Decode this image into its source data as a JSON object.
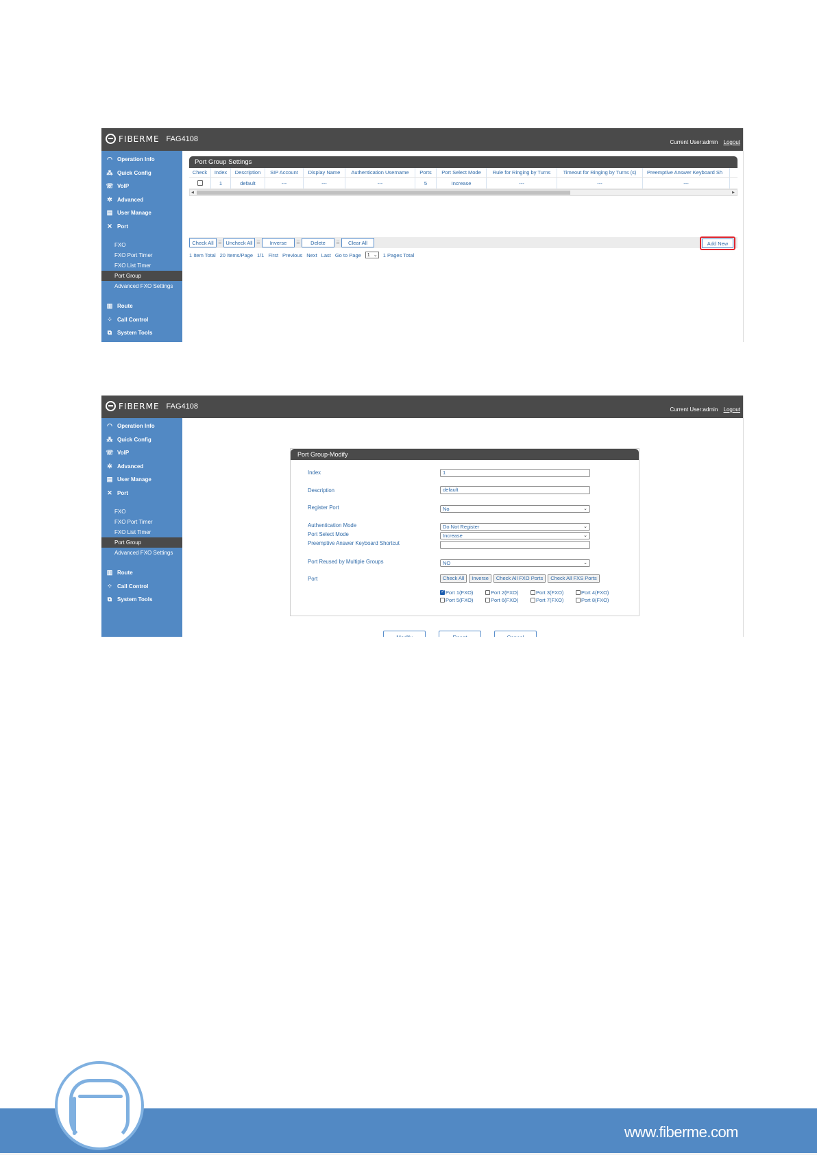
{
  "brand": {
    "logo_text": "FIBERME",
    "model": "FAG4108",
    "current_user": "Current User:admin",
    "logout": "Logout"
  },
  "sidebar": {
    "items": [
      {
        "label": "Operation Info",
        "icon": "gauge-icon"
      },
      {
        "label": "Quick Config",
        "icon": "network-icon"
      },
      {
        "label": "VoIP",
        "icon": "phone-icon"
      },
      {
        "label": "Advanced",
        "icon": "gear-icon"
      },
      {
        "label": "User Manage",
        "icon": "users-icon"
      },
      {
        "label": "Port",
        "icon": "tools-icon"
      }
    ],
    "port_subitems": [
      "FXO",
      "FXO Port Timer",
      "FXO List Timer",
      "Port Group",
      "Advanced FXO Settings"
    ],
    "active_subitem": "Port Group",
    "bottom_items": [
      {
        "label": "Route",
        "icon": "route-icon"
      },
      {
        "label": "Call Control",
        "icon": "call-control-icon"
      },
      {
        "label": "System Tools",
        "icon": "system-tools-icon"
      }
    ]
  },
  "settings": {
    "title": "Port Group Settings",
    "columns": [
      "Check",
      "Index",
      "Description",
      "SIP Account",
      "Display Name",
      "Authentication Username",
      "Ports",
      "Port Select Mode",
      "Rule for Ringing by Turns",
      "Timeout for Ringing by Turns (s)",
      "Preemptive Answer Keyboard Sh"
    ],
    "row": {
      "index": "1",
      "description": "default",
      "sip_account": "---",
      "display_name": "---",
      "auth_username": "---",
      "ports": "5",
      "port_select_mode": "Increase",
      "rule_ringing": "---",
      "timeout_ringing": "---",
      "preemptive": "---"
    },
    "buttons": {
      "check_all": "Check All",
      "uncheck_all": "Uncheck All",
      "inverse": "Inverse",
      "delete": "Delete",
      "clear_all": "Clear All",
      "add_new": "Add New"
    },
    "pager": {
      "total": "1 Item Total",
      "per_page": "20 Items/Page",
      "page": "1/1",
      "first": "First",
      "previous": "Previous",
      "next": "Next",
      "last": "Last",
      "goto": "Go to Page",
      "page_value": "1",
      "pages_total": "1 Pages Total"
    }
  },
  "modify": {
    "title": "Port Group-Modify",
    "labels": {
      "index": "Index",
      "description": "Description",
      "register_port": "Register Port",
      "auth_mode": "Authentication Mode",
      "port_select_mode": "Port Select Mode",
      "preemptive": "Preemptive Answer Keyboard Shortcut",
      "reused": "Port Reused by Multiple Groups",
      "port": "Port"
    },
    "values": {
      "index": "1",
      "description": "default",
      "register_port": "No",
      "auth_mode": "Do Not Register",
      "port_select_mode": "Increase",
      "preemptive": "",
      "reused": "NO"
    },
    "port_buttons": [
      "Check All",
      "Inverse",
      "Check All FXO Ports",
      "Check All FXS Ports"
    ],
    "ports": [
      {
        "label": "Port 1(FXO)",
        "checked": true
      },
      {
        "label": "Port 2(FXO)",
        "checked": false
      },
      {
        "label": "Port 3(FXO)",
        "checked": false
      },
      {
        "label": "Port 4(FXO)",
        "checked": false
      },
      {
        "label": "Port 5(FXO)",
        "checked": false
      },
      {
        "label": "Port 6(FXO)",
        "checked": false
      },
      {
        "label": "Port 7(FXO)",
        "checked": false
      },
      {
        "label": "Port 8(FXO)",
        "checked": false
      }
    ],
    "actions": {
      "modify": "Modify",
      "reset": "Reset",
      "cancel": "Cancel"
    }
  },
  "footer": {
    "url": "www.fiberme.com"
  },
  "colors": {
    "sidebar": "#5289c4",
    "topbar": "#4a4a4a",
    "link": "#2f6aa8",
    "highlight": "#e0262e"
  }
}
